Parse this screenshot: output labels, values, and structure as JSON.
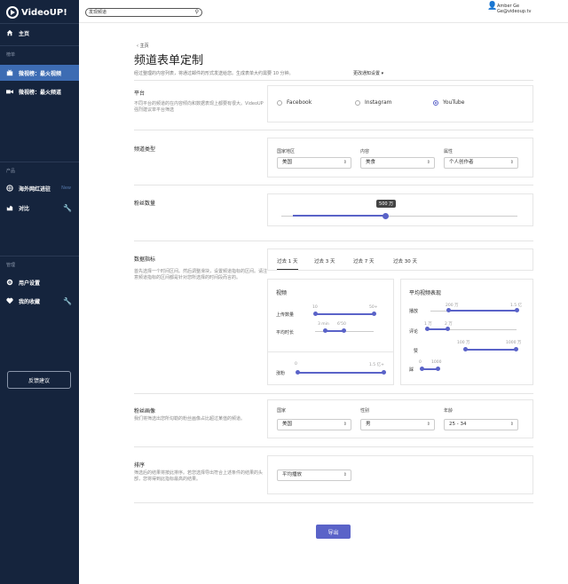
{
  "app": {
    "name": "VideoUP!"
  },
  "search": {
    "value": "发现频道"
  },
  "user": {
    "name": "Amber Ge",
    "email": "Ge@videoup.tv"
  },
  "sidebar": {
    "home": "主页",
    "sec1": "榜单",
    "item_top_videos": "微视榜：最火视频",
    "item_top_channels": "微视榜：最火频道",
    "sec2": "产品",
    "item_influencer": "海外网红进驻",
    "new_badge": "New",
    "item_compare": "对比",
    "sec3": "管理",
    "item_user_settings": "用户设置",
    "item_favorites": "我的收藏",
    "feedback": "反馈建议"
  },
  "page": {
    "back": "主页",
    "title": "频道表单定制",
    "subtitle": "经过整理的内容列表，将通过邮件的形式发送给您。生成表单大约需要 10 分钟。",
    "notify": "更改通知设置"
  },
  "platform": {
    "title": "平台",
    "desc": "不同平台的频道的在内容倾向和数据表现上都要有很大。VideoUP 强烈建议单平台筛选",
    "options": [
      "Facebook",
      "Instagram",
      "YouTube"
    ],
    "selected": "YouTube"
  },
  "channel_type": {
    "title": "频道类型",
    "country_label": "国家地区",
    "country_value": "美国",
    "content_label": "内容",
    "content_value": "美食",
    "attr_label": "属性",
    "attr_value": "个人创作者"
  },
  "followers": {
    "title": "粉丝数量",
    "value": "500 万",
    "fraction": 0.44
  },
  "metrics": {
    "title": "数据指标",
    "desc": "首先选择一个时间区间。然后调整滑块，设置频道指标的区间。请注意频道指标的区间都是针对您所选择的时间段而言的。",
    "tabs": [
      "过去 1 天",
      "过去 3 天",
      "过去 7 天",
      "过去 30 天"
    ],
    "video_title": "视频",
    "uploads_label": "上传数量",
    "uploads_min": "10",
    "uploads_max": "50+",
    "duration_label": "平均时长",
    "duration_min": "3 min",
    "duration_max": "6'50",
    "fans_label": "涨粉",
    "fans_min": "0",
    "fans_max": "1.5 亿+",
    "avg_title": "平均视频表现",
    "plays_label": "播放",
    "plays_min": "200 万",
    "plays_max": "1.5 亿",
    "comments_label": "评论",
    "comments_min": "1 万",
    "comments_max": "2 万",
    "likes_label": "赞",
    "likes_min": "100 万",
    "likes_max": "1000 万",
    "dislikes_label": "踩",
    "dislikes_min": "0",
    "dislikes_max": "1000"
  },
  "audience": {
    "title": "粉丝画像",
    "desc": "我们将筛选出您所勾勒的粉丝画像占比超过某值的频道。",
    "country_label": "国家",
    "country_value": "美国",
    "gender_label": "性别",
    "gender_value": "男",
    "age_label": "年龄",
    "age_value": "25 - 34"
  },
  "sort": {
    "title": "排序",
    "desc": "筛选后的结果将按此排序。若您选择导出符合上述条件的结果的头部，您将得到此指标最高的结果。",
    "value": "平均播放"
  },
  "export": {
    "label": "导出"
  },
  "colors": {
    "sidebar": "#15243d",
    "active": "#3d6cb3",
    "accent": "#5a63c8"
  }
}
